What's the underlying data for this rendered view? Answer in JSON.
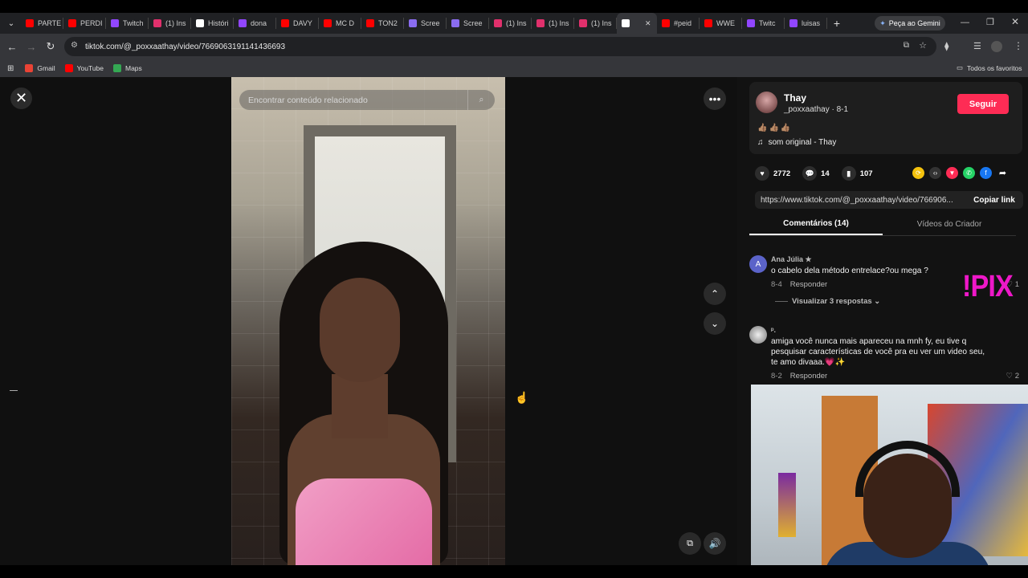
{
  "browser": {
    "tabs": [
      {
        "label": "PARTE",
        "color": "#ff0000"
      },
      {
        "label": "PERDI",
        "color": "#ff0000"
      },
      {
        "label": "Twitch",
        "color": "#9146ff"
      },
      {
        "label": "(1) Ins",
        "color": "#e1306c"
      },
      {
        "label": "Históri",
        "color": "#ffffff"
      },
      {
        "label": "dona",
        "color": "#9146ff"
      },
      {
        "label": "DAVY",
        "color": "#ff0000"
      },
      {
        "label": "MC D",
        "color": "#ff0000"
      },
      {
        "label": "TON2",
        "color": "#ff0000"
      },
      {
        "label": "Scree",
        "color": "#8a6cf0"
      },
      {
        "label": "Scree",
        "color": "#8a6cf0"
      },
      {
        "label": "(1) Ins",
        "color": "#e1306c"
      },
      {
        "label": "(1) Ins",
        "color": "#e1306c"
      },
      {
        "label": "(1) Ins",
        "color": "#e1306c"
      },
      {
        "label": "",
        "color": "#ffffff"
      },
      {
        "label": "#peid",
        "color": "#ff0000"
      },
      {
        "label": "WWE",
        "color": "#ff0000"
      },
      {
        "label": "Twitc",
        "color": "#9146ff"
      },
      {
        "label": "luisas",
        "color": "#9146ff"
      }
    ],
    "new_tab": "+",
    "gemini_button": "Peça ao Gemini",
    "url": "tiktok.com/@_poxxaathay/video/7669063191141436693",
    "bookmarks": [
      {
        "label": "Gmail",
        "color": "#ea4335"
      },
      {
        "label": "YouTube",
        "color": "#ff0000"
      },
      {
        "label": "Maps",
        "color": "#34a853"
      }
    ],
    "all_bookmarks": "Todos os favoritos"
  },
  "video": {
    "search_placeholder": "Encontrar conteúdo relacionado"
  },
  "author": {
    "name": "Thay",
    "handle": "_poxxaathay · 8-1",
    "follow": "Seguir",
    "description": "👍🏽👍🏽👍🏽",
    "sound": "som original - Thay"
  },
  "stats": {
    "likes": "2772",
    "comments": "14",
    "saves": "107"
  },
  "share": {
    "link": "https://www.tiktok.com/@_poxxaathay/video/766906...",
    "copy": "Copiar link"
  },
  "tabs": {
    "comments": "Comentários (14)",
    "creator_videos": "Vídeos do Criador"
  },
  "comments": [
    {
      "avatar": "A",
      "user": "Ana Júlia ★",
      "text": "o cabelo dela método entrelace?ou mega ?",
      "date": "8-4",
      "reply": "Responder",
      "likes": "1"
    },
    {
      "avatar": "",
      "user": "ᵖ.",
      "text": "amiga você nunca mais apareceu na mnh fy, eu tive q pesquisar características de você pra eu ver um video seu, te amo divaaa.💗✨",
      "date": "8-2",
      "reply": "Responder",
      "likes": "2"
    }
  ],
  "view_replies": "Visualizar 3 respostas ⌄",
  "overlay_text": "!PIX"
}
